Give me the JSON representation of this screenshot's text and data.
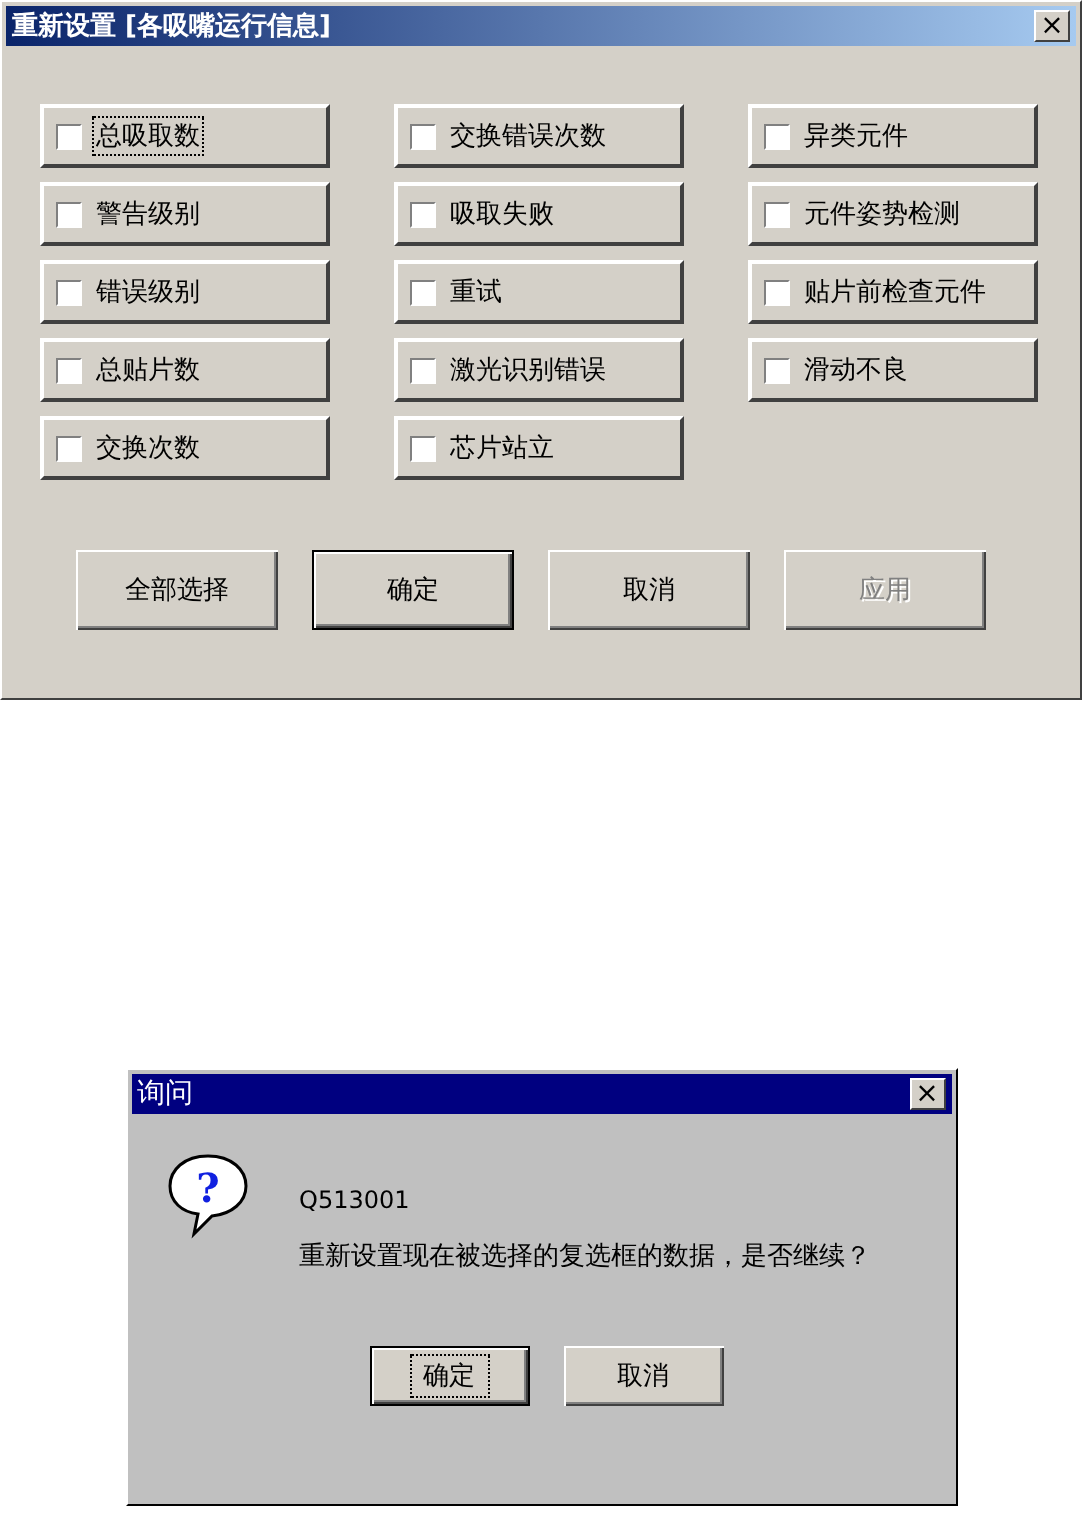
{
  "reset_dialog": {
    "title": "重新设置 [各吸嘴运行信息]",
    "close": "×",
    "checkboxes": [
      {
        "label": "总吸取数",
        "checked": false,
        "focused": true
      },
      {
        "label": "交换错误次数",
        "checked": false,
        "focused": false
      },
      {
        "label": "异类元件",
        "checked": false,
        "focused": false
      },
      {
        "label": "警告级别",
        "checked": false,
        "focused": false
      },
      {
        "label": "吸取失败",
        "checked": false,
        "focused": false
      },
      {
        "label": "元件姿势检测",
        "checked": false,
        "focused": false
      },
      {
        "label": "错误级别",
        "checked": false,
        "focused": false
      },
      {
        "label": "重试",
        "checked": false,
        "focused": false
      },
      {
        "label": "贴片前检查元件",
        "checked": false,
        "focused": false
      },
      {
        "label": "总贴片数",
        "checked": false,
        "focused": false
      },
      {
        "label": "激光识别错误",
        "checked": false,
        "focused": false
      },
      {
        "label": "滑动不良",
        "checked": false,
        "focused": false
      },
      {
        "label": "交换次数",
        "checked": false,
        "focused": false
      },
      {
        "label": "芯片站立",
        "checked": false,
        "focused": false
      }
    ],
    "buttons": [
      {
        "label": "全部选择",
        "default": false,
        "disabled": false
      },
      {
        "label": "确定",
        "default": true,
        "disabled": false
      },
      {
        "label": "取消",
        "default": false,
        "disabled": false
      },
      {
        "label": "应用",
        "default": false,
        "disabled": true
      }
    ]
  },
  "query_dialog": {
    "title": "询问",
    "close": "×",
    "icon": "?",
    "code": "Q513001",
    "message": "重新设置现在被选择的复选框的数据，是否继续？",
    "buttons": [
      {
        "label": "确定",
        "default": true,
        "focused": true
      },
      {
        "label": "取消",
        "default": false,
        "focused": false
      }
    ]
  }
}
